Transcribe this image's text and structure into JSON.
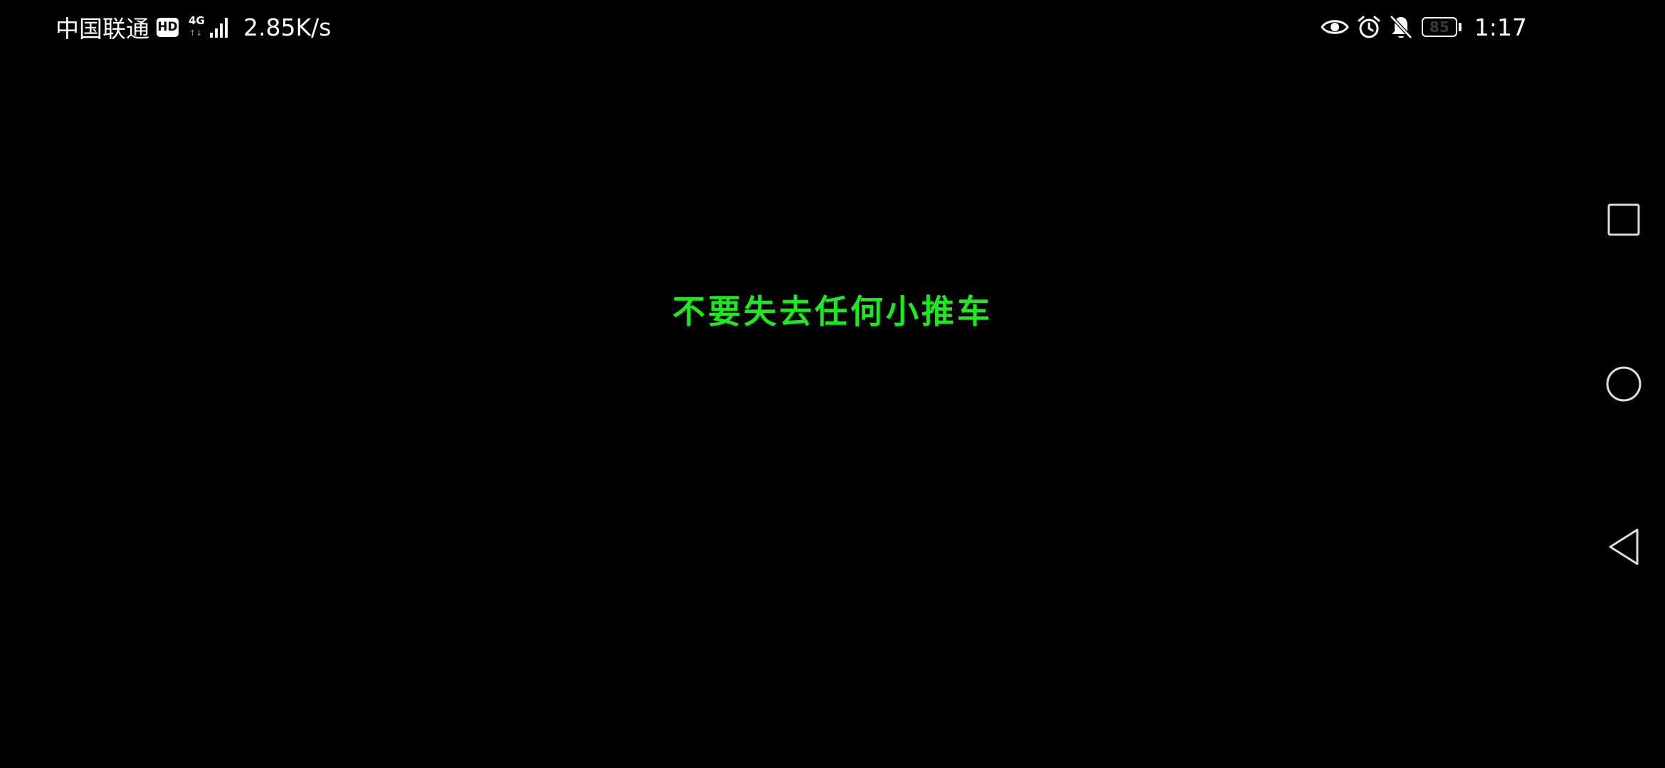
{
  "status_bar": {
    "carrier": "中国联通",
    "hd_badge": "HD",
    "network_type": "4G",
    "network_arrows": "↑↓",
    "net_speed": "2.85K/s",
    "icons": [
      "eye-icon",
      "alarm-icon",
      "bell-off-icon"
    ],
    "battery_level": "85",
    "battery_fraction": 0.85,
    "time": "1:17"
  },
  "game": {
    "message": "不要失去任何小推车",
    "message_color": "#1ee81e"
  },
  "nav_bar": {
    "buttons": [
      "recent-apps",
      "home",
      "back"
    ]
  }
}
